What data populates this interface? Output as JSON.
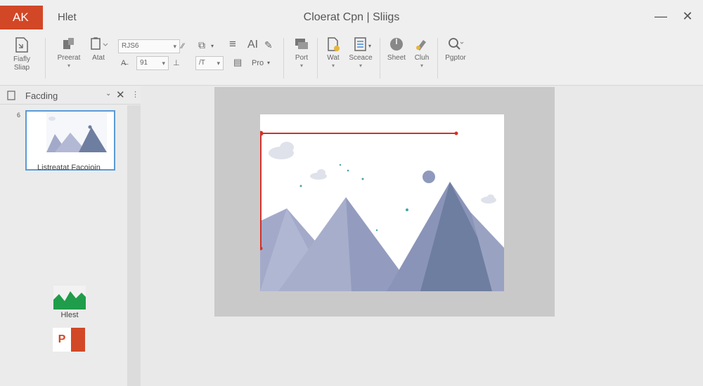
{
  "titlebar": {
    "app_badge": "AK",
    "menu_item": "Hlet",
    "doc_title": "Cloerat Cpn | Sliigs",
    "minimize": "—",
    "close": "✕"
  },
  "ribbon": {
    "groups": [
      {
        "label_line1": "Fiafly",
        "label_line2": "Sliap",
        "icon": "page-icon"
      },
      {
        "label": "Preerat",
        "icon": "paste-icon"
      },
      {
        "label": "Atat",
        "icon": "clipboard-icon"
      },
      {
        "label": "Port",
        "icon": "layout-icon"
      },
      {
        "label": "Wat",
        "icon": "document-icon"
      },
      {
        "label": "Sceace",
        "icon": "grid-icon"
      },
      {
        "label": "Sheet",
        "icon": "circle-icon"
      },
      {
        "label": "Cluh",
        "icon": "brush-icon"
      },
      {
        "label": "Pgptor",
        "icon": "search-icon"
      }
    ],
    "font_name": "RJS6",
    "font_size": "91",
    "font_tool_a": "AI",
    "font_tool_b": "Pro",
    "font_tool_c": "/T"
  },
  "pane": {
    "title": "Facding",
    "slide_number": "6",
    "thumbnail_label": "Listreatat Facoioin",
    "item_label": "Hlest"
  },
  "colors": {
    "accent": "#d24726",
    "selection": "#5b9bd5",
    "guide": "#d0322a",
    "mountain_light": "#a3aac9",
    "mountain_dark": "#6e7ea0"
  }
}
